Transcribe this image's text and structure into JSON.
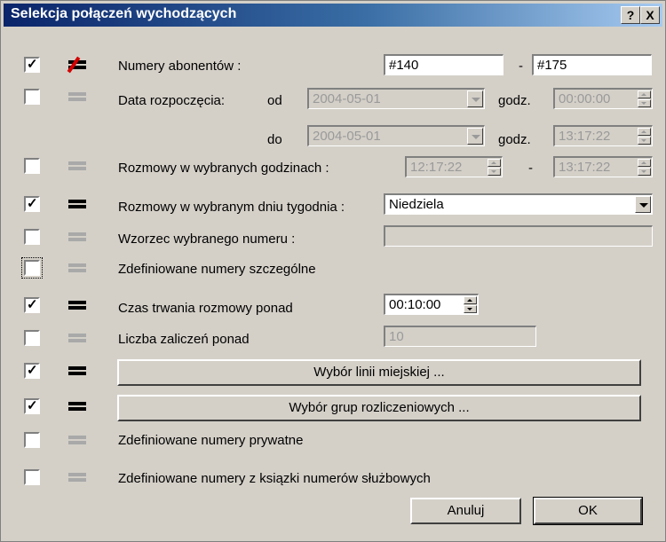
{
  "window": {
    "title": "Selekcja połączeń wychodzących",
    "help_button": "?",
    "close_button": "X"
  },
  "rows": {
    "subscribers": {
      "label": "Numery abonentów :",
      "checked": true,
      "operator": "not-equal",
      "from_value": "#140",
      "separator": "-",
      "to_value": "#175"
    },
    "start_date": {
      "label": "Data rozpoczęcia:",
      "checked": false,
      "operator": "equal-disabled",
      "from_label": "od",
      "to_label": "do",
      "from_date": "2004-05-01",
      "to_date": "2004-05-01",
      "hour_label": "godz.",
      "from_time": "00:00:00",
      "to_time": "13:17:22"
    },
    "hours": {
      "label": "Rozmowy w wybranych godzinach :",
      "checked": false,
      "operator": "equal-disabled",
      "from_time": "12:17:22",
      "separator": "-",
      "to_time": "13:17:22"
    },
    "weekday": {
      "label": "Rozmowy w wybranym dniu tygodnia :",
      "checked": true,
      "operator": "equal",
      "value": "Niedziela"
    },
    "pattern": {
      "label": "Wzorzec wybranego numeru :",
      "checked": false,
      "operator": "equal-disabled",
      "value": ""
    },
    "special": {
      "label": "Zdefiniowane numery szczególne",
      "checked": false,
      "operator": "equal-disabled"
    },
    "duration": {
      "label": "Czas trwania rozmowy ponad",
      "checked": true,
      "operator": "equal",
      "value": "00:10:00"
    },
    "charges": {
      "label": "Liczba zaliczeń ponad",
      "checked": false,
      "operator": "equal-disabled",
      "value": "10"
    },
    "lines": {
      "button": "Wybór linii miejskiej ...",
      "checked": true,
      "operator": "equal"
    },
    "groups": {
      "button": "Wybór grup rozliczeniowych ...",
      "checked": true,
      "operator": "equal"
    },
    "private": {
      "label": "Zdefiniowane numery prywatne",
      "checked": false,
      "operator": "equal-disabled"
    },
    "business": {
      "label": "Zdefiniowane numery z ksiązki numerów służbowych",
      "checked": false,
      "operator": "equal-disabled"
    }
  },
  "footer": {
    "cancel": "Anuluj",
    "ok": "OK"
  }
}
